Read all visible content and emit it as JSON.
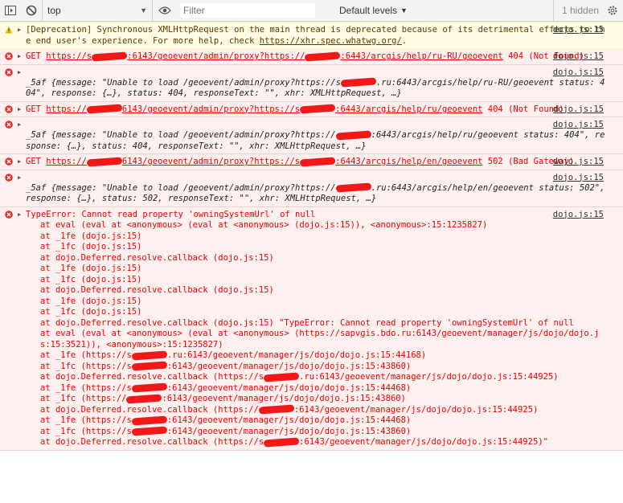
{
  "toolbar": {
    "context": "top",
    "filter_placeholder": "Filter",
    "levels_label": "Default levels",
    "hidden_count": "1 hidden"
  },
  "messages": [
    {
      "type": "warn",
      "text": "[Deprecation] Synchronous XMLHttpRequest on the main thread is deprecated because of its detrimental effects to the end user's experience. For more help, check ",
      "link": "https://xhr.spec.whatwg.org/",
      "after": ".",
      "source": "dojo.js:15"
    },
    {
      "type": "err",
      "prefix": "GET ",
      "link": "https://s████████:6143/geoevent/admin/proxy?https://████████:6443/arcgis/help/ru-RU/geoevent",
      "after": " 404 (Not Found)",
      "source": "dojo.js:15"
    },
    {
      "type": "err",
      "obj_name": "_5af",
      "obj_text": "{message: \"Unable to load /geoevent/admin/proxy?https://s████████.ru:6443/arcgis/help/ru-RU/geoevent status: 404\", response: {…}, status: 404, responseText: \"\", xhr: XMLHttpRequest, …}",
      "source": "dojo.js:15"
    },
    {
      "type": "err",
      "prefix": "GET ",
      "link": "https://████████6143/geoevent/admin/proxy?https://s████████:6443/arcgis/help/ru/geoevent",
      "after": " 404 (Not Found)",
      "source": "dojo.js:15"
    },
    {
      "type": "err",
      "obj_name": "_5af",
      "obj_text": "{message: \"Unable to load /geoevent/admin/proxy?https://████████:6443/arcgis/help/ru/geoevent status: 404\", response: {…}, status: 404, responseText: \"\", xhr: XMLHttpRequest, …}",
      "source": "dojo.js:15"
    },
    {
      "type": "err",
      "prefix": "GET ",
      "link": "https://████████6143/geoevent/admin/proxy?https://s████████:6443/arcgis/help/en/geoevent",
      "after": " 502 (Bad Gateway)",
      "source": "dojo.js:15"
    },
    {
      "type": "err",
      "obj_name": "_5af",
      "obj_text": "{message: \"Unable to load /geoevent/admin/proxy?https://████████.ru:6443/arcgis/help/en/geoevent status: 502\", response: {…}, status: 502, responseText: \"\", xhr: XMLHttpRequest, …}",
      "source": "dojo.js:15"
    }
  ],
  "trace": {
    "header": "TypeError: Cannot read property 'owningSystemUrl' of null",
    "source": "dojo.js:15",
    "lines": [
      "at eval (eval at <anonymous> (eval at <anonymous> (dojo.js:15)), <anonymous>:15:1235827)",
      "at _1fe (dojo.js:15)",
      "at _1fc (dojo.js:15)",
      "at dojo.Deferred.resolve.callback (dojo.js:15)",
      "at _1fe (dojo.js:15)",
      "at _1fc (dojo.js:15)",
      "at dojo.Deferred.resolve.callback (dojo.js:15)",
      "at _1fe (dojo.js:15)",
      "at _1fc (dojo.js:15)",
      "at dojo.Deferred.resolve.callback (dojo.js:15) \"TypeError: Cannot read property 'owningSystemUrl' of null",
      "at eval (eval at <anonymous> (eval at <anonymous> (https://sapvgis.bdo.ru:6143/geoevent/manager/js/dojo/dojo.js:15:3521)), <anonymous>:15:1235827)",
      "at _1fe (https://s████████.ru:6143/geoevent/manager/js/dojo/dojo.js:15:44168)",
      "at _1fc (https://s████████:6143/geoevent/manager/js/dojo/dojo.js:15:43860)",
      "at dojo.Deferred.resolve.callback (https://s████████.ru:6143/geoevent/manager/js/dojo/dojo.js:15:44925)",
      "at _1fe (https://s████████:6143/geoevent/manager/js/dojo/dojo.js:15:44468)",
      "at _1fc (https://████████:6143/geoevent/manager/js/dojo/dojo.js:15:43860)",
      "at dojo.Deferred.resolve.callback (https://████████:6143/geoevent/manager/js/dojo/dojo.js:15:44925)",
      "at _1fe (https://s████████:6143/geoevent/manager/js/dojo/dojo.js:15:44468)",
      "at _1fc (https://s████████:6143/geoevent/manager/js/dojo/dojo.js:15:43860)",
      "at dojo.Deferred.resolve.callback (https://s████████:6143/geoevent/manager/js/dojo/dojo.js:15:44925)\""
    ]
  },
  "colors": {
    "error_text": "#ee0000",
    "error_bg": "#fff0f0",
    "warn_bg": "#fffbe5",
    "redaction": "#ee0000"
  }
}
